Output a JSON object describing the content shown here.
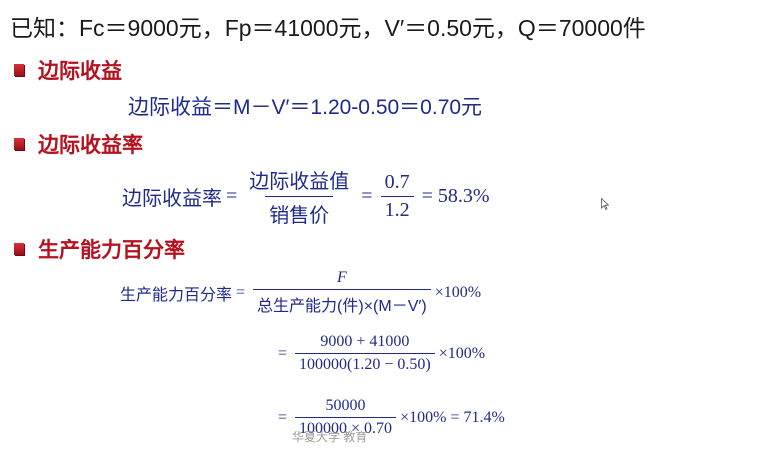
{
  "given": {
    "text": "已知：Fc＝9000元，Fp＝41000元，V′＝0.50元，Q＝70000件"
  },
  "sections": {
    "marginal_income": {
      "title": "边际收益",
      "formula": "边际收益＝M－V′＝1.20-0.50＝0.70元"
    },
    "marginal_income_rate": {
      "title": "边际收益率",
      "lhs": "边际收益率",
      "eq1": "=",
      "frac1_num": "边际收益值",
      "frac1_den": "销售价",
      "eq2": "=",
      "frac2_num": "0.7",
      "frac2_den": "1.2",
      "result": "= 58.3%"
    },
    "capacity_rate": {
      "title": "生产能力百分率",
      "line1": {
        "lhs": "生产能力百分率",
        "eq": "=",
        "num": "F",
        "den": "总生产能力(件)×(M－V′)",
        "tail": "×100%"
      },
      "line2": {
        "eq": "=",
        "num": "9000 + 41000",
        "den": "100000(1.20 − 0.50)",
        "tail": "×100%"
      },
      "line3": {
        "eq": "=",
        "num": "50000",
        "den": "100000 × 0.70",
        "tail": "×100% = 71.4%"
      }
    }
  },
  "watermark": {
    "text": "华夏大学 教育"
  },
  "colors": {
    "heading": "#b3121e",
    "formula": "#1f2a8a",
    "bullet": "#c0202a"
  }
}
